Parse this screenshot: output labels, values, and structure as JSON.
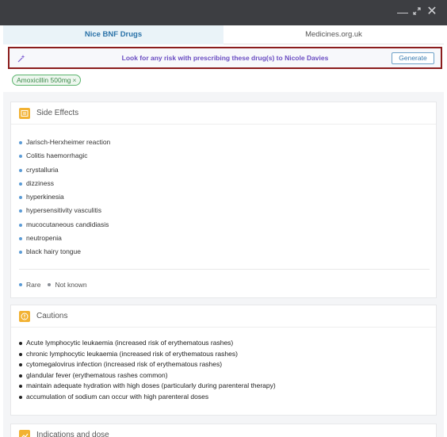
{
  "window": {
    "controls": [
      "minimize",
      "expand",
      "close"
    ]
  },
  "tabs": [
    {
      "label": "Nice BNF Drugs",
      "active": true
    },
    {
      "label": "Medicines.org.uk",
      "active": false
    }
  ],
  "banner": {
    "icon": "magic-wand-icon",
    "text": "Look for any risk with prescribing these drug(s) to Nicole Davies",
    "button": "Generate"
  },
  "chip": {
    "label": "Amoxicillin 500mg",
    "remove": "×"
  },
  "side_effects": {
    "title": "Side Effects",
    "items": [
      {
        "label": "Jarisch-Herxheimer reaction",
        "frequency": "rare"
      },
      {
        "label": "Colitis haemorrhagic",
        "frequency": "rare"
      },
      {
        "label": "crystalluria",
        "frequency": "rare"
      },
      {
        "label": "dizziness",
        "frequency": "rare"
      },
      {
        "label": "hyperkinesia",
        "frequency": "rare"
      },
      {
        "label": "hypersensitivity vasculitis",
        "frequency": "rare"
      },
      {
        "label": "mucocutaneous candidiasis",
        "frequency": "rare"
      },
      {
        "label": "neutropenia",
        "frequency": "rare"
      },
      {
        "label": "black hairy tongue",
        "frequency": "rare"
      }
    ],
    "legend": [
      {
        "label": "Rare",
        "color": "#5b9bd5"
      },
      {
        "label": "Not known",
        "color": "#8a8f96"
      }
    ]
  },
  "cautions": {
    "title": "Cautions",
    "items": [
      "Acute lymphocytic leukaemia (increased risk of erythematous rashes)",
      "chronic lymphocytic leukaemia (increased risk of erythematous rashes)",
      "cytomegalovirus infection (increased risk of erythematous rashes)",
      "glandular fever (erythematous rashes common)",
      "maintain adequate hydration with high doses (particularly during parenteral therapy)",
      "accumulation of sodium can occur with high parenteral doses"
    ]
  },
  "indications": {
    "title": "Indications and dose"
  },
  "colors": {
    "titlebar": "#3d3e42",
    "active_tab_bg": "#eaf3f8",
    "banner_border": "#8b1d1d",
    "banner_text": "#6a4cc2",
    "card_icon": "#f2b233",
    "chip_green": "#5cb56e"
  }
}
